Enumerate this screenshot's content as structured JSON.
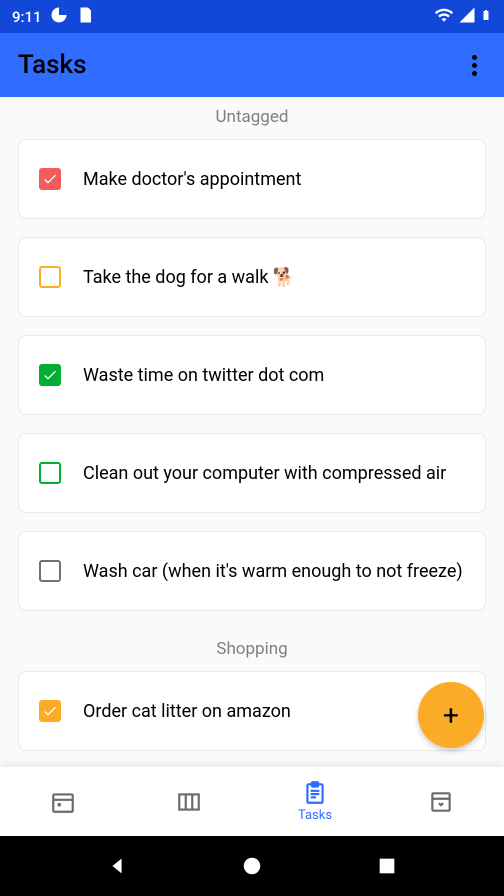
{
  "status": {
    "time": "9:11"
  },
  "header": {
    "title": "Tasks"
  },
  "sections": {
    "untagged": "Untagged",
    "shopping": "Shopping"
  },
  "tasks": {
    "t1": {
      "text": "Make doctor's appointment"
    },
    "t2": {
      "text": "Take the dog for a walk 🐕"
    },
    "t3": {
      "text": "Waste time on twitter dot com"
    },
    "t4": {
      "text": "Clean out your computer with compressed air"
    },
    "t5": {
      "text": "Wash car (when it's warm enough to not freeze)"
    },
    "t6": {
      "text": "Order cat litter on amazon"
    }
  },
  "nav": {
    "tasks_label": "Tasks"
  }
}
